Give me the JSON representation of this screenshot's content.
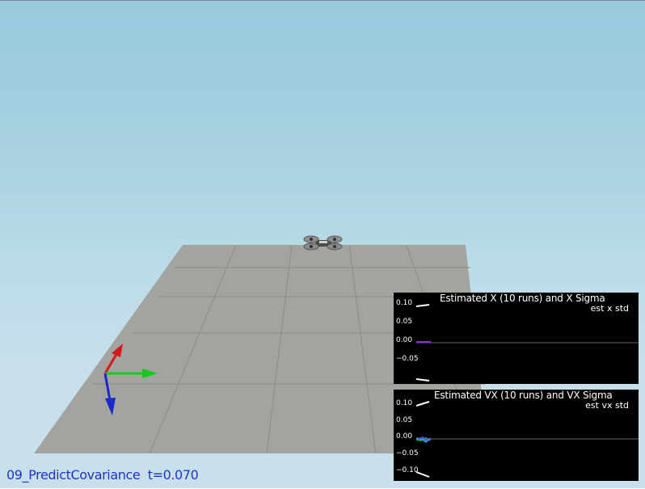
{
  "status": {
    "scenario": "09_PredictCovariance",
    "time_text": "t=0.070"
  },
  "colors": {
    "text_blue": "#1c35c8",
    "axis_x": "#d41a1a",
    "axis_y": "#18c81e",
    "axis_z": "#1a29c8",
    "floor": "#a3a3a0"
  },
  "icons": [
    "quadrotor-icon",
    "coordinate-axes-icon"
  ],
  "plots": [
    {
      "title": "Estimated X (10 runs) and X Sigma",
      "legend": "est x std",
      "yticks": [
        "0.10",
        "0.05",
        "0.00",
        "−0.05"
      ]
    },
    {
      "title": "Estimated VX (10 runs) and VX Sigma",
      "legend": "est vx std",
      "yticks": [
        "0.10",
        "0.05",
        "0.00",
        "−0.05",
        "−0.10"
      ]
    }
  ]
}
